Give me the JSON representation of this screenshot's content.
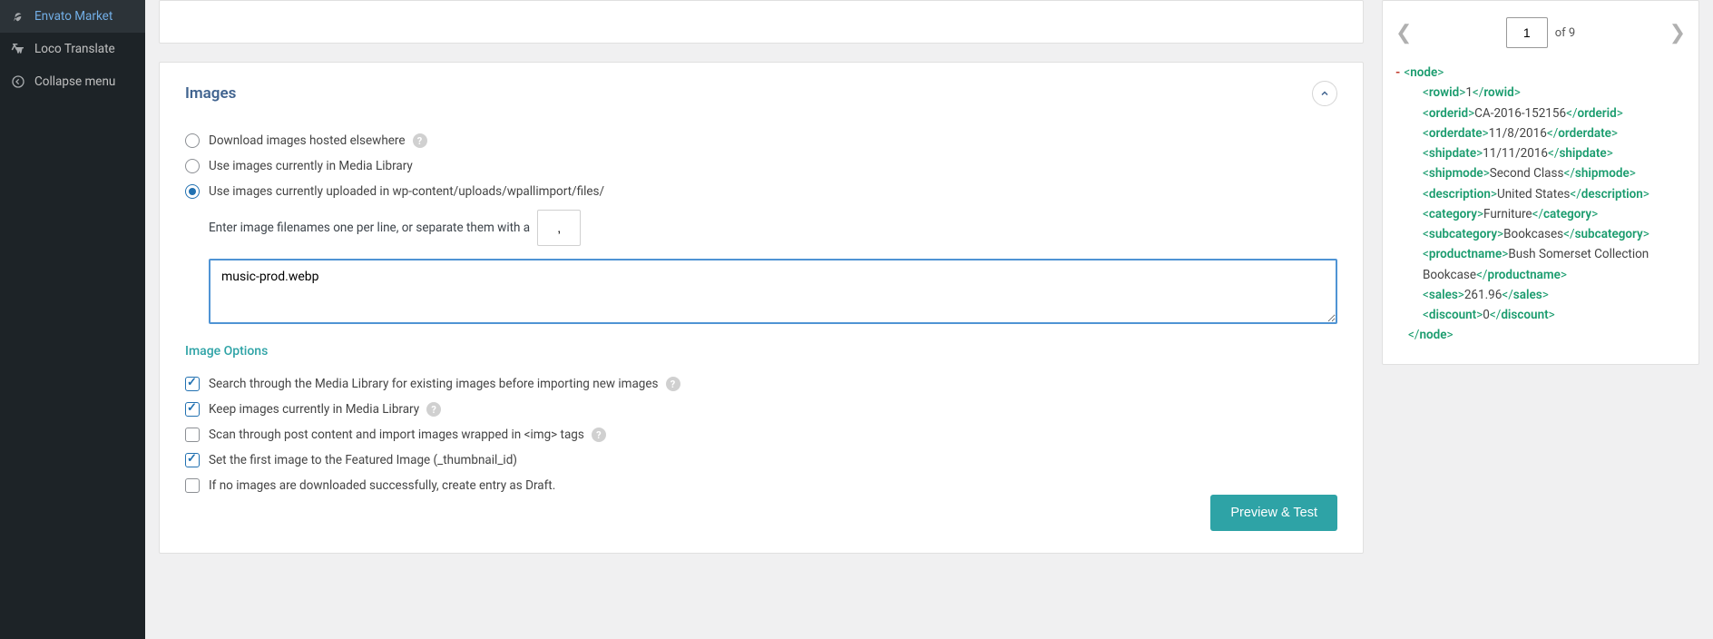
{
  "sidebar": {
    "items": [
      {
        "label": "Envato Market",
        "icon": "leaf"
      },
      {
        "label": "Loco Translate",
        "icon": "translate"
      },
      {
        "label": "Collapse menu",
        "icon": "collapse"
      }
    ]
  },
  "images": {
    "title": "Images",
    "radios": {
      "download": "Download images hosted elsewhere",
      "media_lib": "Use images currently in Media Library",
      "uploads": "Use images currently uploaded in wp-content/uploads/wpallimport/files/"
    },
    "separator_text": "Enter image filenames one per line, or separate them with a",
    "separator_value": ",",
    "filenames_value": "music-prod.webp",
    "options_label": "Image Options",
    "checks": {
      "search_media": "Search through the Media Library for existing images before importing new images",
      "keep_media": "Keep images currently in Media Library",
      "scan_img_tags": "Scan through post content and import images wrapped in <img> tags",
      "featured": "Set the first image to the Featured Image (_thumbnail_id)",
      "draft": "If no images are downloaded successfully, create entry as Draft."
    },
    "preview_btn": "Preview & Test"
  },
  "pager": {
    "page": "1",
    "of_label": "of 9"
  },
  "xml": {
    "node": "node",
    "fields": [
      {
        "tag": "rowid",
        "val": "1"
      },
      {
        "tag": "orderid",
        "val": "CA-2016-152156"
      },
      {
        "tag": "orderdate",
        "val": "11/8/2016"
      },
      {
        "tag": "shipdate",
        "val": "11/11/2016"
      },
      {
        "tag": "shipmode",
        "val": "Second Class"
      },
      {
        "tag": "description",
        "val": "United States"
      },
      {
        "tag": "category",
        "val": "Furniture"
      },
      {
        "tag": "subcategory",
        "val": "Bookcases"
      },
      {
        "tag": "productname",
        "val": "Bush Somerset Collection Bookcase"
      },
      {
        "tag": "sales",
        "val": "261.96"
      },
      {
        "tag": "discount",
        "val": "0"
      }
    ]
  }
}
